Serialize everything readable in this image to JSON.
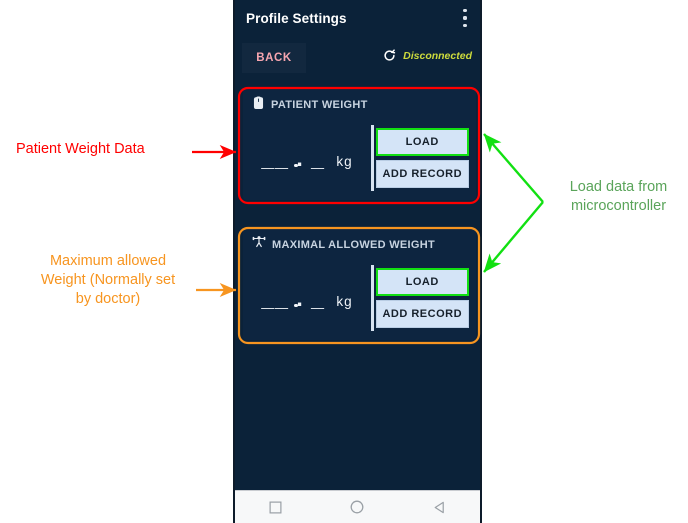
{
  "app": {
    "title": "Profile Settings",
    "overflow_icon": "kebab-menu-icon"
  },
  "subbar": {
    "back_label": "BACK",
    "refresh_icon": "refresh-icon",
    "connection_status": "Disconnected",
    "connection_color": "#cddb3c"
  },
  "cards": [
    {
      "id": "patient-weight",
      "icon": "weighing-scale-icon",
      "title": "PATIENT WEIGHT",
      "value": "__ . _",
      "unit": "kg",
      "buttons": [
        {
          "label": "LOAD",
          "highlight": true
        },
        {
          "label": "ADD RECORD",
          "highlight": false
        }
      ],
      "outline_color": "#ff0000"
    },
    {
      "id": "maximal-allowed-weight",
      "icon": "weightlifter-icon",
      "title": "MAXIMAL ALLOWED WEIGHT",
      "value": "__ . _",
      "unit": "kg",
      "buttons": [
        {
          "label": "LOAD",
          "highlight": true
        },
        {
          "label": "ADD RECORD",
          "highlight": false
        }
      ],
      "outline_color": "#f79520"
    }
  ],
  "navbar": {
    "items": [
      {
        "icon": "square-recents-icon"
      },
      {
        "icon": "circle-home-icon"
      },
      {
        "icon": "triangle-back-icon"
      }
    ]
  },
  "annotations": [
    {
      "id": "patient-weight-annotation",
      "text": "Patient Weight Data",
      "color": "#ff0000"
    },
    {
      "id": "maximum-allowed-weight-annotation",
      "text": "Maximum allowed Weight (Normally set by doctor)",
      "line1": "Maximum allowed",
      "line2": "Weight (Normally set",
      "line3": "by doctor)",
      "color": "#f79520"
    },
    {
      "id": "load-data-annotation",
      "text": "Load data from microcontroller",
      "line1": "Load data from",
      "line2": "microcontroller",
      "color": "#5aa45a",
      "arrow_color": "#12e012"
    }
  ],
  "colors": {
    "screen_bg": "#0b2239",
    "card_bg": "#0d2540",
    "button_bg": "#d4e4f7",
    "accent_green": "#12e012",
    "accent_red": "#ff0000",
    "accent_orange": "#f79520",
    "back_text": "#f7a6b0"
  }
}
